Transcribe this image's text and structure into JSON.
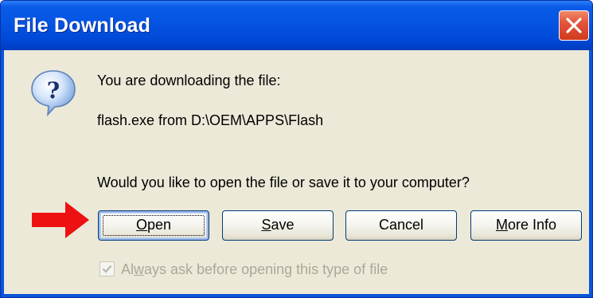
{
  "window": {
    "title": "File Download"
  },
  "dialog": {
    "line1": "You are downloading the file:",
    "line2": "flash.exe from D:\\OEM\\APPS\\Flash",
    "question": "Would you like to open the file or save it to your computer?"
  },
  "buttons": {
    "open": {
      "prefix": "",
      "accel": "O",
      "suffix": "pen"
    },
    "save": {
      "prefix": "",
      "accel": "S",
      "suffix": "ave"
    },
    "cancel": {
      "label": "Cancel"
    },
    "more_info": {
      "prefix": "",
      "accel": "M",
      "suffix": "ore Info"
    }
  },
  "checkbox": {
    "checked": true,
    "enabled": false,
    "label_prefix": "Al",
    "label_accel": "w",
    "label_suffix": "ays ask before opening this type of file"
  },
  "icons": {
    "dialog_icon": "question-icon",
    "close": "close-icon",
    "annotation": "red-arrow-icon"
  },
  "colors": {
    "titlebar": "#0554e3",
    "close_button": "#e4553a",
    "client_bg": "#ece9d8",
    "arrow": "#ee1111",
    "disabled_text": "#aca899"
  }
}
